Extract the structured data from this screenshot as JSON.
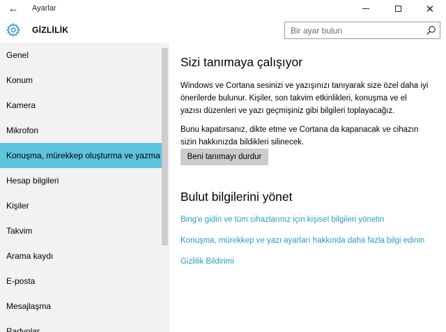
{
  "window": {
    "title": "Ayarlar",
    "back_glyph": "←",
    "minimize_label": "minimize",
    "maximize_label": "maximize",
    "close_glyph": "✕"
  },
  "header": {
    "section_title": "GİZLİLİK",
    "search_placeholder": "Bir ayar bulun"
  },
  "sidebar": {
    "items": [
      {
        "label": "Genel"
      },
      {
        "label": "Konum"
      },
      {
        "label": "Kamera"
      },
      {
        "label": "Mikrofon"
      },
      {
        "label": "Konuşma, mürekkep oluşturma ve yazma",
        "active": true
      },
      {
        "label": "Hesap bilgileri"
      },
      {
        "label": "Kişiler"
      },
      {
        "label": "Takvim"
      },
      {
        "label": "Arama kaydı"
      },
      {
        "label": "E-posta"
      },
      {
        "label": "Mesajlaşma"
      },
      {
        "label": "Radyolar"
      }
    ]
  },
  "main": {
    "section1": {
      "heading": "Sizi tanımaya çalışıyor",
      "para1_line1": "Windows ve Cortana sesinizi ve yazışınızı tanıyarak size özel daha iyi",
      "para1_line2": "önerilerde bulunur. Kişiler, son takvim etkinlikleri, konuşma ve el",
      "para1_line3": "yazısı düzenleri ve yazı geçmişiniz gibi bilgileri toplayacağız.",
      "para2_line1": "Bunu kapatırsanız, dikte etme ve Cortana da kapanacak ve cihazın",
      "para2_line2": "sizin hakkınızda bildikleri silinecek.",
      "button_label": "Beni tanımayı durdur"
    },
    "section2": {
      "heading": "Bulut bilgilerini yönet",
      "link1": "Bing'e gidin ve tüm cihazlarınız için kişisel bilgileri yönetin",
      "link2": "Konuşma, mürekkep ve yazı ayarları hakkında daha fazla bilgi edinin",
      "link3": "Gizlilik Bildirimi"
    }
  },
  "colors": {
    "accent": "#5ec3dc",
    "link": "#2a9bc4",
    "sidebar_bg": "#f2f2f2",
    "button_bg": "#cccccc"
  }
}
